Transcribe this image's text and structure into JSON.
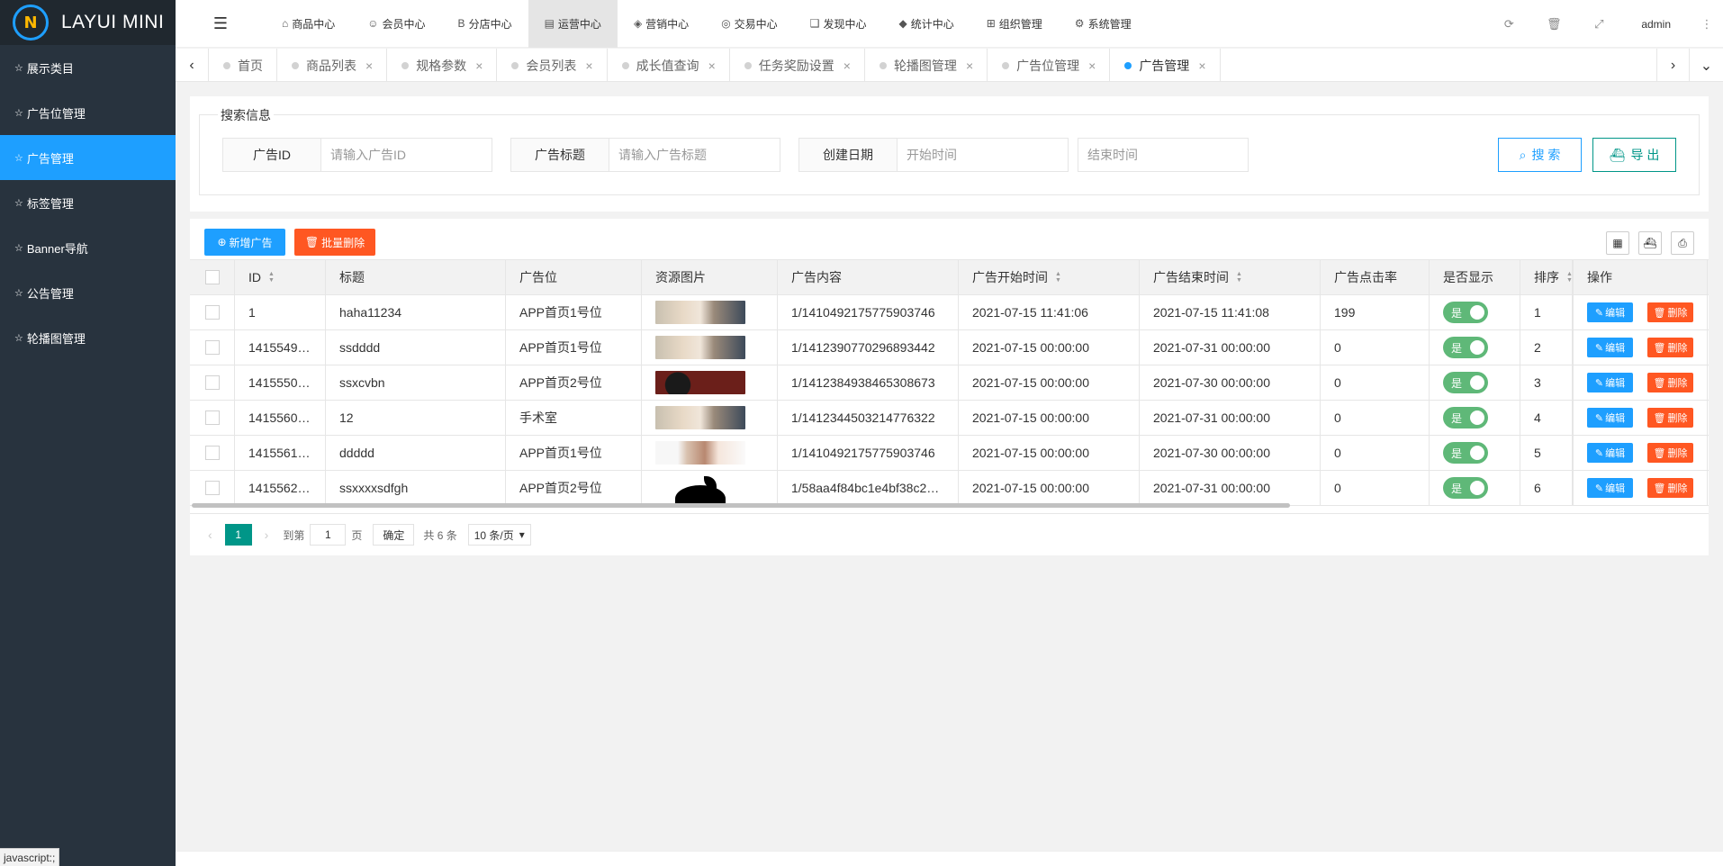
{
  "app": {
    "logo_text": "LAYUI MINI",
    "logo_mark": "N"
  },
  "sidebar": {
    "items": [
      {
        "label": "展示类目",
        "active": false
      },
      {
        "label": "广告位管理",
        "active": false
      },
      {
        "label": "广告管理",
        "active": true
      },
      {
        "label": "标签管理",
        "active": false
      },
      {
        "label": "Banner导航",
        "active": false
      },
      {
        "label": "公告管理",
        "active": false
      },
      {
        "label": "轮播图管理",
        "active": false
      }
    ]
  },
  "header": {
    "nav": [
      {
        "label": "商品中心",
        "icon": "home-icon"
      },
      {
        "label": "会员中心",
        "icon": "user-icon"
      },
      {
        "label": "分店中心",
        "icon": "bold-b-icon"
      },
      {
        "label": "运营中心",
        "icon": "calendar-icon",
        "active": true
      },
      {
        "label": "营销中心",
        "icon": "tag-icon"
      },
      {
        "label": "交易中心",
        "icon": "coin-icon"
      },
      {
        "label": "发现中心",
        "icon": "book-icon"
      },
      {
        "label": "统计中心",
        "icon": "chart-icon"
      },
      {
        "label": "组织管理",
        "icon": "org-icon"
      },
      {
        "label": "系统管理",
        "icon": "gear-icon"
      }
    ],
    "user": "admin"
  },
  "tabs": [
    {
      "label": "首页",
      "closable": false
    },
    {
      "label": "商品列表",
      "closable": true
    },
    {
      "label": "规格参数",
      "closable": true
    },
    {
      "label": "会员列表",
      "closable": true
    },
    {
      "label": "成长值查询",
      "closable": true
    },
    {
      "label": "任务奖励设置",
      "closable": true
    },
    {
      "label": "轮播图管理",
      "closable": true
    },
    {
      "label": "广告位管理",
      "closable": true
    },
    {
      "label": "广告管理",
      "closable": true,
      "active": true
    }
  ],
  "search": {
    "legend": "搜索信息",
    "ad_id_label": "广告ID",
    "ad_id_placeholder": "请输入广告ID",
    "ad_title_label": "广告标题",
    "ad_title_placeholder": "请输入广告标题",
    "date_label": "创建日期",
    "start_placeholder": "开始时间",
    "end_placeholder": "结束时间",
    "search_btn": "搜 索",
    "export_btn": "导 出"
  },
  "toolbar": {
    "add_btn": "新增广告",
    "batch_delete_btn": "批量删除"
  },
  "table": {
    "columns": {
      "id": "ID",
      "title": "标题",
      "position": "广告位",
      "image": "资源图片",
      "content": "广告内容",
      "start": "广告开始时间",
      "end": "广告结束时间",
      "rate": "广告点击率",
      "show": "是否显示",
      "sort": "排序",
      "op": "操作"
    },
    "rows": [
      {
        "id": "1",
        "title": "haha11234",
        "position": "APP首页1号位",
        "image": "photo",
        "content": "1/1410492175775903746",
        "start": "2021-07-15 11:41:06",
        "end": "2021-07-15 11:41:08",
        "rate": "199",
        "show": "是",
        "sort": "1"
      },
      {
        "id": "1415549…",
        "title": "ssdddd",
        "position": "APP首页1号位",
        "image": "photo",
        "content": "1/1412390770296893442",
        "start": "2021-07-15 00:00:00",
        "end": "2021-07-31 00:00:00",
        "rate": "0",
        "show": "是",
        "sort": "2"
      },
      {
        "id": "1415550…",
        "title": "ssxcvbn",
        "position": "APP首页2号位",
        "image": "dark",
        "content": "1/1412384938465308673",
        "start": "2021-07-15 00:00:00",
        "end": "2021-07-30 00:00:00",
        "rate": "0",
        "show": "是",
        "sort": "3"
      },
      {
        "id": "1415560…",
        "title": "12",
        "position": "手术室",
        "image": "photo",
        "content": "1/1412344503214776322",
        "start": "2021-07-15 00:00:00",
        "end": "2021-07-31 00:00:00",
        "rate": "0",
        "show": "是",
        "sort": "4"
      },
      {
        "id": "1415561…",
        "title": "ddddd",
        "position": "APP首页1号位",
        "image": "face",
        "content": "1/1410492175775903746",
        "start": "2021-07-15 00:00:00",
        "end": "2021-07-30 00:00:00",
        "rate": "0",
        "show": "是",
        "sort": "5"
      },
      {
        "id": "1415562…",
        "title": "ssxxxxsdfgh",
        "position": "APP首页2号位",
        "image": "apple",
        "content": "1/58aa4f84bc1e4bf38c2…",
        "start": "2021-07-15 00:00:00",
        "end": "2021-07-31 00:00:00",
        "rate": "0",
        "show": "是",
        "sort": "6"
      }
    ],
    "edit_btn": "编辑",
    "delete_btn": "删除"
  },
  "pager": {
    "current_page": "1",
    "goto_label": "到第",
    "goto_value": "1",
    "page_label": "页",
    "confirm_btn": "确定",
    "total_text": "共 6 条",
    "page_size": "10 条/页"
  },
  "status_bar": "javascript:;",
  "colors": {
    "primary": "#1e9fff",
    "danger": "#ff5722",
    "success": "#5fb878",
    "teal": "#009688",
    "sidebar": "#28333e"
  }
}
